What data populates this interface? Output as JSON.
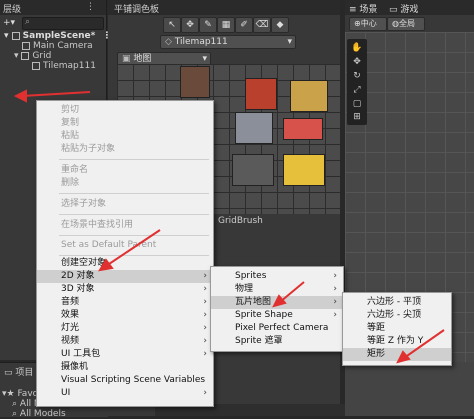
{
  "hierarchy": {
    "tab": "层级",
    "scene": "SampleScene*",
    "items": [
      "Main Camera",
      "Grid",
      "Tilemap111"
    ]
  },
  "palette": {
    "tab": "平铺调色板",
    "tilemap": "Tilemap111",
    "palette_name": "地图",
    "brush": "GridBrush"
  },
  "scene": {
    "tab_scene": "场景",
    "tab_game": "游戏",
    "pivot": "中心",
    "space": "全局"
  },
  "project": {
    "tab": "项目",
    "fav": "Favori",
    "all": "All M",
    "all_models": "All Models"
  },
  "context_menu": {
    "items": [
      {
        "label": "剪切",
        "disabled": true
      },
      {
        "label": "复制",
        "disabled": true
      },
      {
        "label": "粘贴",
        "disabled": true
      },
      {
        "label": "粘贴为子对象",
        "disabled": true
      },
      {
        "label": "重命名",
        "disabled": true
      },
      {
        "label": "删除",
        "disabled": true
      },
      {
        "label": "选择子对象",
        "disabled": true
      },
      {
        "label": "在场景中查找引用",
        "disabled": true
      },
      {
        "label": "Set as Default Parent",
        "disabled": true
      },
      {
        "label": "创建空对象",
        "disabled": false
      },
      {
        "label": "2D 对象",
        "disabled": false
      },
      {
        "label": "3D 对象",
        "disabled": false
      },
      {
        "label": "音频",
        "disabled": false
      },
      {
        "label": "效果",
        "disabled": false
      },
      {
        "label": "灯光",
        "disabled": false
      },
      {
        "label": "视频",
        "disabled": false
      },
      {
        "label": "UI 工具包",
        "disabled": false
      },
      {
        "label": "摄像机",
        "disabled": false
      },
      {
        "label": "Visual Scripting Scene Variables",
        "disabled": false
      },
      {
        "label": "UI",
        "disabled": false
      }
    ]
  },
  "submenu_2d": {
    "items": [
      "Sprites",
      "物理",
      "瓦片地图",
      "Sprite Shape",
      "Pixel Perfect Camera",
      "Sprite 遮罩"
    ]
  },
  "submenu_tilemap": {
    "items": [
      "六边形 - 平顶",
      "六边形 - 尖顶",
      "等距",
      "等距 Z 作为 Y",
      "矩形"
    ]
  },
  "colors": {
    "annotation_arrow": "#e03030",
    "menu_bg": "#f0f0f0",
    "highlight": "#cfcfcf"
  }
}
